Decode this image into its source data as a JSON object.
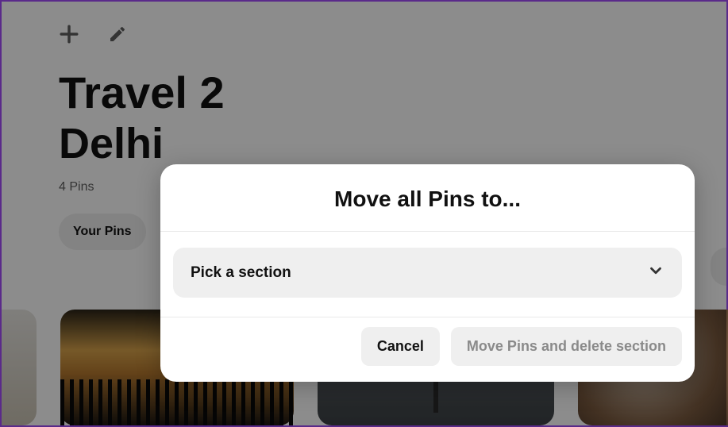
{
  "board": {
    "title": "Travel 2",
    "section": "Delhi",
    "pin_count": "4 Pins"
  },
  "filters": {
    "your_pins": "Your Pins"
  },
  "modal": {
    "title": "Move all Pins to...",
    "select_placeholder": "Pick a section",
    "cancel_label": "Cancel",
    "confirm_label": "Move Pins and delete section"
  },
  "icons": {
    "plus": "plus-icon",
    "pencil": "pencil-icon",
    "chevron_down": "chevron-down-icon"
  }
}
